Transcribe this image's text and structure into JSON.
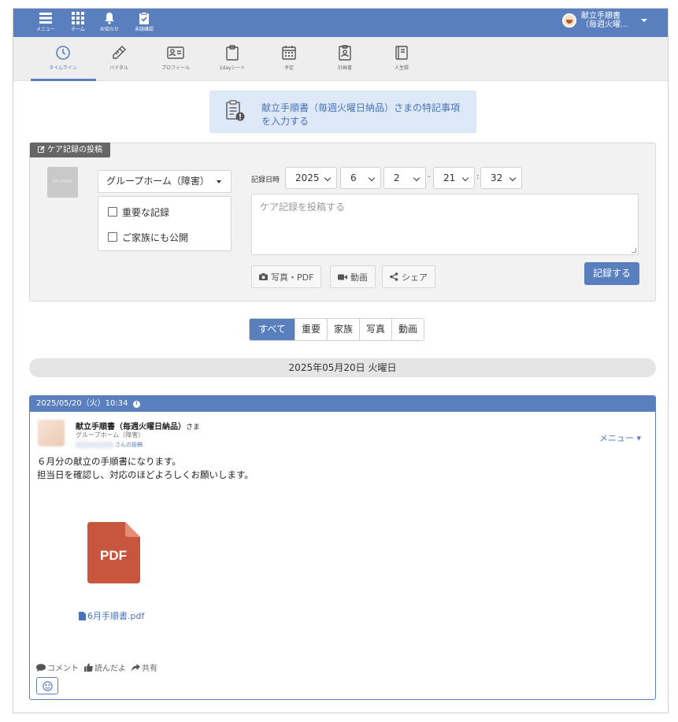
{
  "topbar": {
    "items": [
      {
        "label": "メニュー",
        "icon": "hamburger-icon"
      },
      {
        "label": "チーム",
        "icon": "grid-icon"
      },
      {
        "label": "お知らせ",
        "icon": "bell-icon"
      },
      {
        "label": "未読確認",
        "icon": "clipboard-check-icon"
      }
    ],
    "user_name_line1": "献立手順書",
    "user_name_line2": "（毎週火曜..."
  },
  "tabs": [
    {
      "label": "タイムライン",
      "icon": "clock-icon",
      "active": true
    },
    {
      "label": "バイタル",
      "icon": "thermometer-icon"
    },
    {
      "label": "プロフィール",
      "icon": "id-card-icon"
    },
    {
      "label": "1dayシート",
      "icon": "clipboard-icon"
    },
    {
      "label": "予定",
      "icon": "calendar-icon"
    },
    {
      "label": "計画書",
      "icon": "document-person-icon"
    },
    {
      "label": "人生録",
      "icon": "book-icon"
    }
  ],
  "special_note": {
    "line1": "献立手順書（毎週火曜日納品）さまの特記事項",
    "line2": "を入力する"
  },
  "post_form": {
    "badge": "ケア記録の投稿",
    "noimage": "NO IMAGE",
    "group": "グループホーム（障害）",
    "important_label": "重要な記録",
    "family_label": "ご家族にも公開",
    "date_label": "記録日時",
    "year": "2025",
    "month": "6",
    "day": "2",
    "hour": "21",
    "minute": "32",
    "dash": "-",
    "colon": ":",
    "placeholder": "ケア記録を投稿する",
    "photo_btn": "写真・PDF",
    "video_btn": "動画",
    "share_btn": "シェア",
    "submit": "記録する"
  },
  "filters": [
    "すべて",
    "重要",
    "家族",
    "写真",
    "動画"
  ],
  "date_separator": "2025年05月20日 火曜日",
  "post": {
    "timestamp": "2025/05/20（火）10:34",
    "name": "献立手順書（毎週火曜日納品）",
    "honorific": "さま",
    "group": "グループホーム（障害）",
    "poster_suffix": "さんの投稿",
    "menu": "メニュー ▾",
    "body_line1": "６月分の献立の手順書になります。",
    "body_line2": "担当日を確認し、対応のほどよろしくお願いします。",
    "pdf_badge": "PDF",
    "file_name": "6月手順書.pdf",
    "comment": "コメント",
    "read": "読んだよ",
    "share": "共有"
  },
  "colors": {
    "primary": "#5a7fbf",
    "note_bg": "#dde9f7",
    "pdf_red": "#c8563f"
  }
}
